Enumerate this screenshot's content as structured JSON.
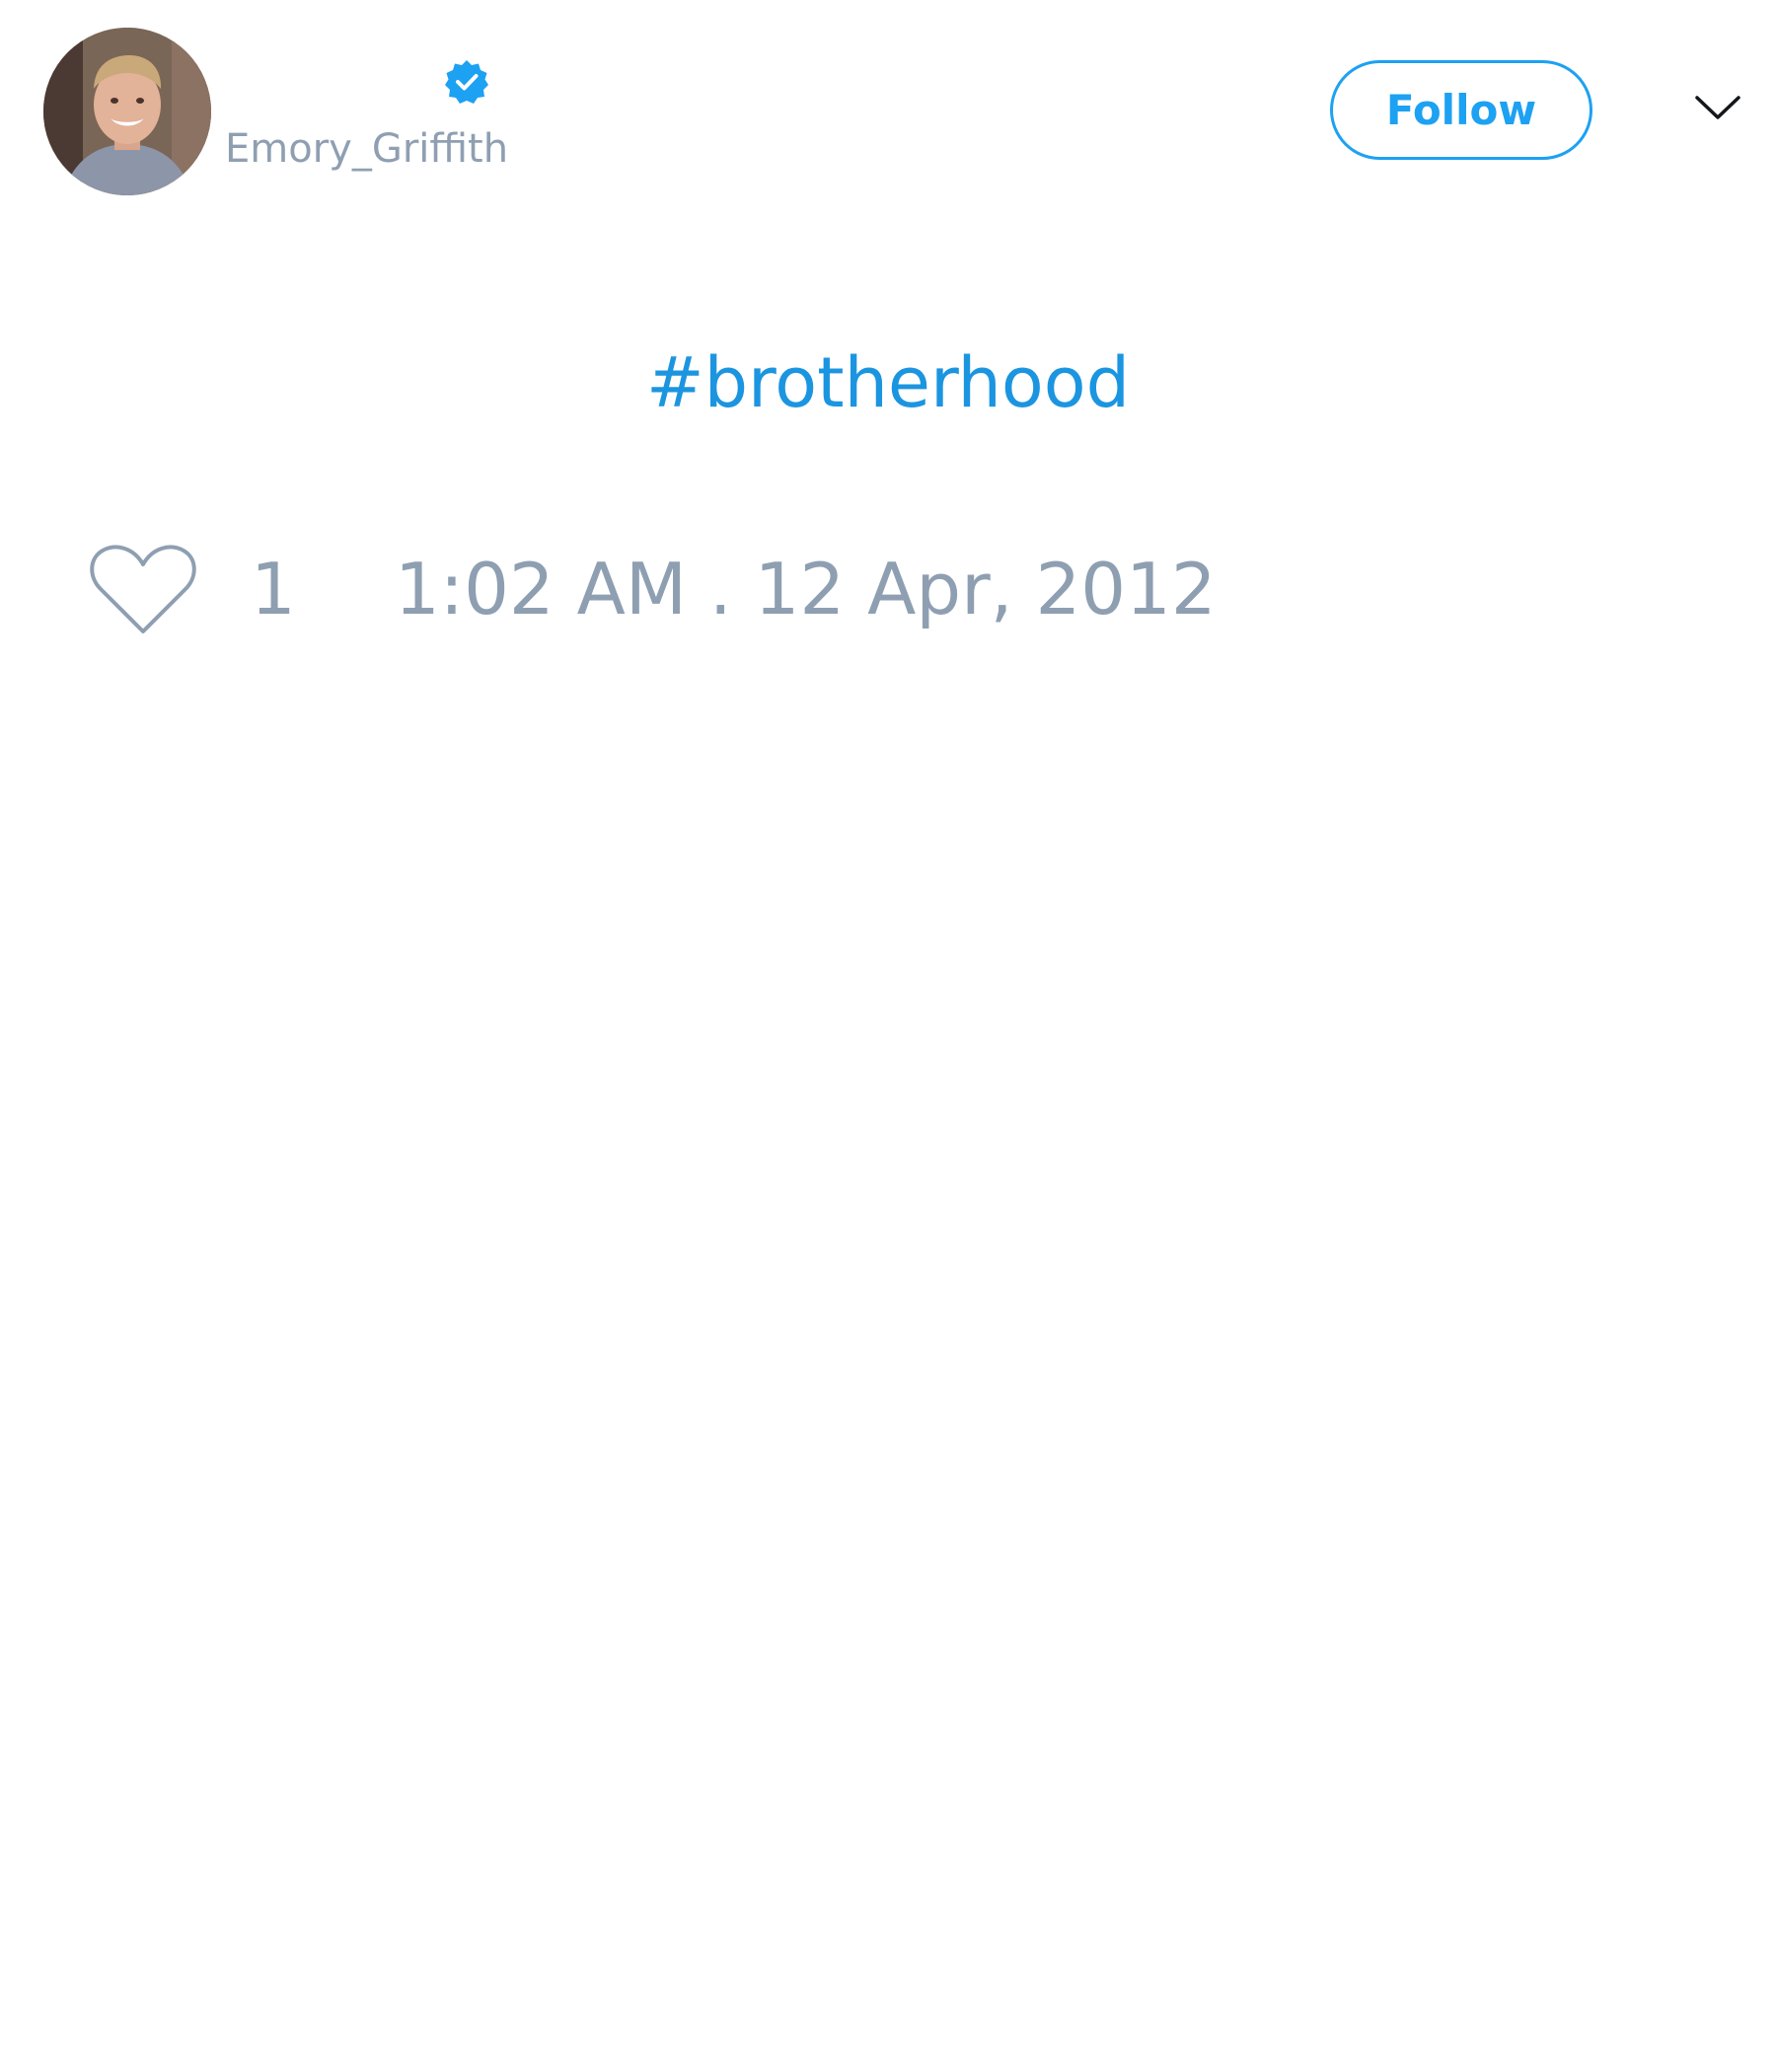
{
  "tweet": {
    "author": {
      "display_name": "",
      "handle": "Emory_Griffith",
      "verified": true,
      "avatar_icon": "profile-photo"
    },
    "follow_label": "Follow",
    "text_prefix": "",
    "hashtag": "#brotherhood",
    "like_count": "1",
    "timestamp": "1:02 AM . 12 Apr, 2012"
  },
  "icons": {
    "verified": "verified-badge-icon",
    "menu": "chevron-down-icon",
    "like": "heart-icon"
  },
  "colors": {
    "accent": "#1da1f2",
    "hashtag": "#1b95e0",
    "muted": "#8f9fb2",
    "background": "#ffffff"
  }
}
